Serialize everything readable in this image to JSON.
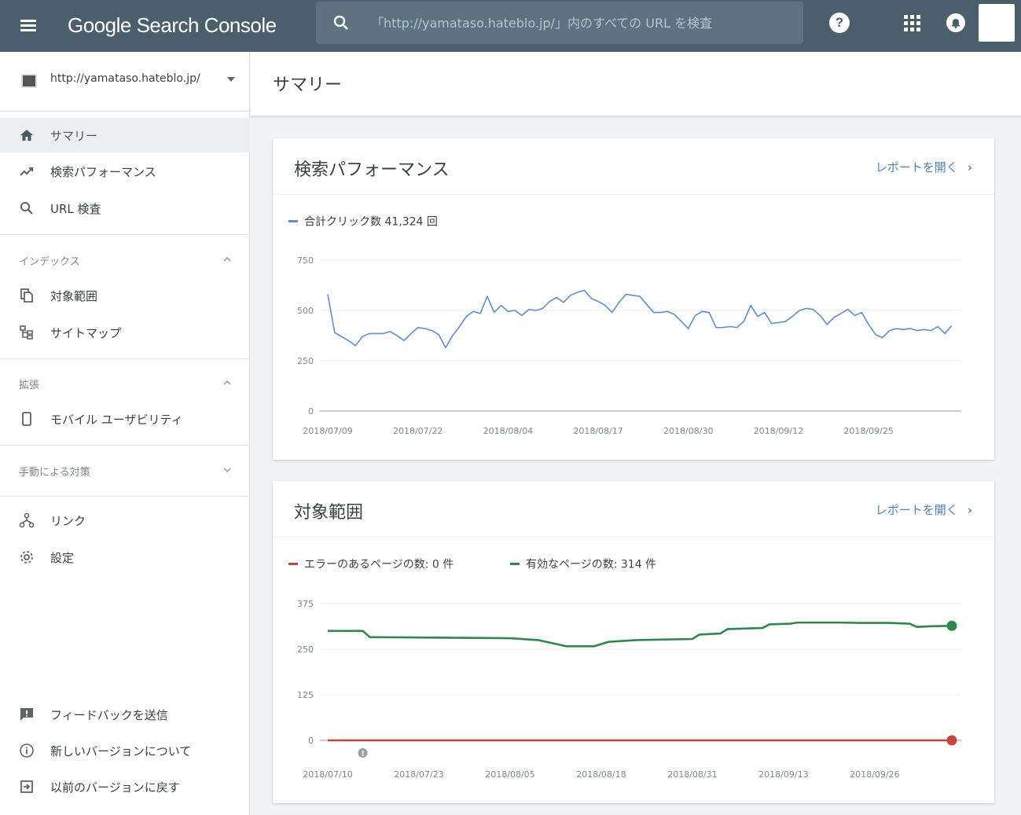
{
  "header": {
    "app_title": "Google Search Console",
    "search_placeholder": "「http://yamataso.hateblo.jp/」内のすべての URL を検査",
    "help_label": "?"
  },
  "sidebar": {
    "property": "http://yamataso.hateblo.jp/",
    "items_top": [
      {
        "label": "サマリー",
        "icon": "home-icon",
        "active": true
      },
      {
        "label": "検索パフォーマンス",
        "icon": "trending-icon"
      },
      {
        "label": "URL 検査",
        "icon": "search-icon"
      }
    ],
    "section_index": "インデックス",
    "items_index": [
      {
        "label": "対象範囲",
        "icon": "copy-icon"
      },
      {
        "label": "サイトマップ",
        "icon": "sitemap-icon"
      }
    ],
    "section_ext": "拡張",
    "items_ext": [
      {
        "label": "モバイル ユーザビリティ",
        "icon": "phone-icon"
      }
    ],
    "section_manual": "手動による対策",
    "items_other": [
      {
        "label": "リンク",
        "icon": "links-icon"
      },
      {
        "label": "設定",
        "icon": "gear-icon"
      }
    ],
    "items_bottom": [
      {
        "label": "フィードバックを送信",
        "icon": "feedback-icon"
      },
      {
        "label": "新しいバージョンについて",
        "icon": "info-icon"
      },
      {
        "label": "以前のバージョンに戻す",
        "icon": "exit-icon"
      }
    ]
  },
  "main": {
    "page_title": "サマリー",
    "performance": {
      "title": "検索パフォーマンス",
      "link": "レポートを開く",
      "legend": "合計クリック数 41,324 回",
      "color": "#5a8ed6"
    },
    "coverage": {
      "title": "対象範囲",
      "link": "レポートを開く",
      "legend_error": "エラーのあるページの数: 0 件",
      "legend_valid": "有効なページの数: 314 件",
      "color_error": "#c5473b",
      "color_valid": "#2a8a4e"
    }
  },
  "chart_data": [
    {
      "type": "line",
      "title": "検索パフォーマンス",
      "series": [
        {
          "name": "合計クリック数 41,324 回",
          "values": [
            580,
            390,
            370,
            350,
            325,
            370,
            385,
            385,
            385,
            395,
            375,
            350,
            385,
            415,
            410,
            400,
            380,
            315,
            375,
            420,
            470,
            495,
            485,
            570,
            490,
            525,
            495,
            500,
            475,
            505,
            500,
            510,
            545,
            565,
            540,
            575,
            590,
            600,
            560,
            545,
            525,
            490,
            540,
            580,
            575,
            570,
            530,
            490,
            490,
            495,
            480,
            445,
            410,
            475,
            495,
            490,
            415,
            415,
            420,
            415,
            445,
            525,
            470,
            490,
            435,
            440,
            445,
            470,
            500,
            510,
            505,
            475,
            430,
            465,
            485,
            505,
            475,
            490,
            430,
            380,
            365,
            400,
            410,
            405,
            410,
            400,
            405,
            400,
            420,
            385,
            425
          ]
        }
      ],
      "x_start": "2018/07/09",
      "x_end": "2018/10/07",
      "xticks": [
        "2018/07/09",
        "2018/07/22",
        "2018/08/04",
        "2018/08/17",
        "2018/08/30",
        "2018/09/12",
        "2018/09/25"
      ],
      "yticks": [
        "750",
        "500",
        "250",
        "0"
      ],
      "ylim": [
        0,
        750
      ],
      "grid": true
    },
    {
      "type": "line",
      "title": "対象範囲",
      "x_start": "2018/07/10",
      "x_end": "2018/10/07",
      "series": [
        {
          "name": "有効なページの数: 314 件",
          "points": [
            [
              "2018/07/10",
              300
            ],
            [
              "2018/07/15",
              300
            ],
            [
              "2018/07/16",
              283
            ],
            [
              "2018/08/05",
              280
            ],
            [
              "2018/08/09",
              275
            ],
            [
              "2018/08/13",
              258
            ],
            [
              "2018/08/17",
              258
            ],
            [
              "2018/08/19",
              270
            ],
            [
              "2018/08/23",
              275
            ],
            [
              "2018/08/31",
              278
            ],
            [
              "2018/09/01",
              290
            ],
            [
              "2018/09/04",
              293
            ],
            [
              "2018/09/05",
              305
            ],
            [
              "2018/09/10",
              308
            ],
            [
              "2018/09/11",
              318
            ],
            [
              "2018/09/14",
              320
            ],
            [
              "2018/09/15",
              323
            ],
            [
              "2018/09/21",
              323
            ],
            [
              "2018/09/24",
              322
            ],
            [
              "2018/09/28",
              322
            ],
            [
              "2018/10/01",
              320
            ],
            [
              "2018/10/02",
              311
            ],
            [
              "2018/10/04",
              313
            ],
            [
              "2018/10/07",
              314
            ]
          ]
        },
        {
          "name": "エラーのあるページの数: 0 件",
          "points": [
            [
              "2018/07/10",
              0
            ],
            [
              "2018/10/07",
              0
            ]
          ]
        }
      ],
      "xticks": [
        "2018/07/10",
        "2018/07/23",
        "2018/08/05",
        "2018/08/18",
        "2018/08/31",
        "2018/09/13",
        "2018/09/26"
      ],
      "yticks": [
        "375",
        "250",
        "125",
        "0"
      ],
      "ylim": [
        0,
        375
      ],
      "grid": true,
      "annotations": [
        {
          "x": "2018/07/15",
          "marker": "info"
        }
      ]
    }
  ]
}
